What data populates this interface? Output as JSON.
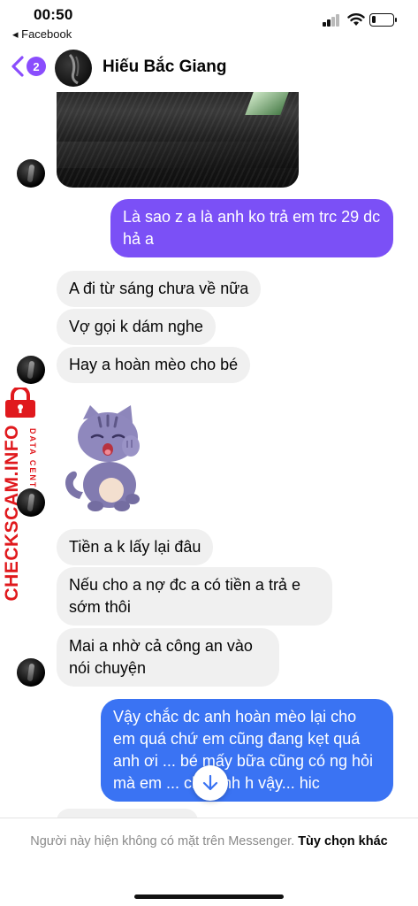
{
  "status_bar": {
    "time": "00:50",
    "back_app": "◂ Facebook",
    "battery_level": 0.2
  },
  "header": {
    "unread_count": "2",
    "contact_name": "Hiếu Bắc Giang",
    "accent_color": "#8a4dfd"
  },
  "messages": [
    {
      "from": "me",
      "text": "Là sao z a là anh ko trả em trc 29 dc hả a",
      "color": "#7b50f6"
    },
    {
      "from": "them",
      "text": "A đi từ sáng chưa về nữa"
    },
    {
      "from": "them",
      "text": "Vợ gọi k dám nghe"
    },
    {
      "from": "them",
      "text": "Hay a hoàn mèo cho bé"
    },
    {
      "from": "them",
      "text": "Tiền a k lấy lại đâu"
    },
    {
      "from": "them",
      "text": "Nếu cho a nợ đc a có tiền a trả e sớm thôi"
    },
    {
      "from": "them",
      "text": "Mai a nhờ cả công an vào nói chuyện"
    },
    {
      "from": "me",
      "text": "Vậy chắc dc anh hoàn mèo lại cho em quá chứ em cũng đang kẹt quá anh ơi ... bé mấy bữa cũng có ng hỏi mà em ... cho anh h vậy... hic",
      "color": "#3a73f3"
    }
  ],
  "watermark": {
    "main": "CHECKSCAM.INFO",
    "sub": "DATA CENTER"
  },
  "footer": {
    "notice": "Người này hiện không có mặt trên Messenger.",
    "action": "Tùy chọn khác"
  }
}
